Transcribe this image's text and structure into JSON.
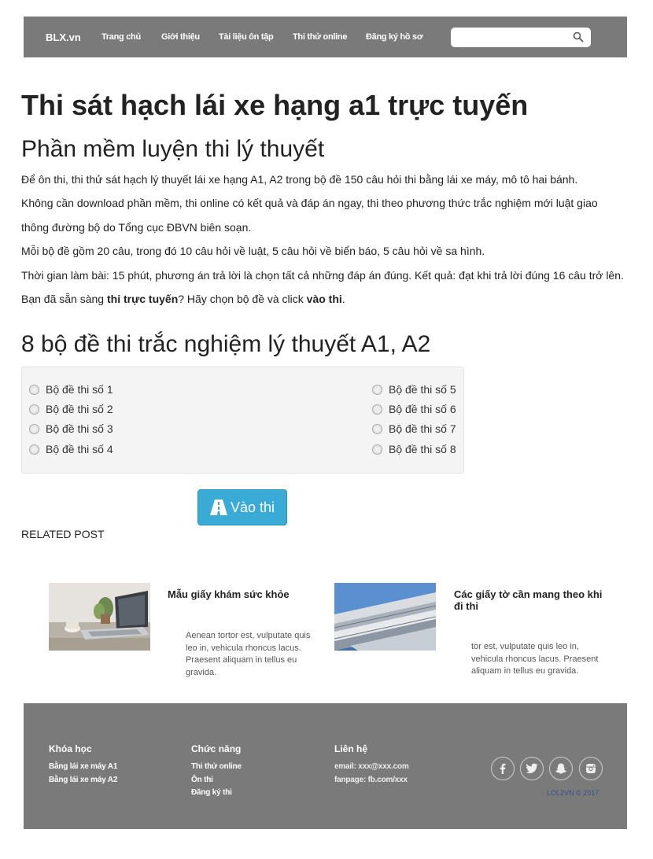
{
  "nav": {
    "brand": "BLX.vn",
    "links": [
      "Trang chủ",
      "Giới thiệu",
      "Tài liệu ôn tập",
      "Thi thử online",
      "Đăng ký hồ sơ"
    ],
    "search_placeholder": ""
  },
  "main": {
    "title": "Thi sát hạch lái xe hạng a1 trực tuyến",
    "subtitle": "Phần mềm luyện thi lý thuyết",
    "paragraphs": [
      "Để ôn thi, thi thử sát hạch lý thuyết lái xe hạng A1, A2 trong bộ đề 150 câu hỏi thi bằng lái xe máy, mô tô hai bánh.",
      "Không cần download phần mềm, thi online có kết quả và đáp án ngay, thi theo phương thức trắc nghiệm mới luật giao",
      "thông đường bộ do Tổng cục ĐBVN biên soạn.",
      "Mỗi bộ đề gồm 20 câu, trong đó 10 câu hỏi về luật, 5 câu hỏi về biển báo, 5 câu hỏi về sa hình.",
      "Thời gian làm bài: 15 phút, phương án trả lời là chọn tất cả những đáp án đúng. Kết quả: đạt khi trả lời đúng 16 câu trở lên."
    ],
    "ready_prefix": "Bạn đã sẵn sàng ",
    "ready_bold1": "thi trực tuyến",
    "ready_middle": "? Hãy chọn bộ đề và click ",
    "ready_bold2": "vào thi",
    "ready_suffix": "."
  },
  "quiz": {
    "heading": "8 bộ đề thi trắc nghiệm lý thuyết A1, A2",
    "options": [
      "Bộ đề thi số 1",
      "Bộ đề thi số 2",
      "Bộ đề thi số 3",
      "Bộ đề thi số 4",
      "Bộ đề thi số 5",
      "Bộ đề thi số 6",
      "Bộ đề thi số 7",
      "Bộ đề thi số 8"
    ],
    "start_label": "Vào thi"
  },
  "related": {
    "title": "RELATED POST",
    "posts": [
      {
        "title": "Mẫu giấy khám sức khỏe",
        "excerpt": [
          "Aenean tortor est, vulputate quis",
          "leo in, vehicula rhoncus lacus.",
          "Praesent aliquam in tellus eu",
          "gravida."
        ]
      },
      {
        "title": "Các giấy tờ cần mang theo khi đi thi",
        "excerpt": [
          "tor est, vulputate quis leo in,",
          "vehicula rhoncus lacus. Praesent",
          "aliquam in tellus eu gravida."
        ]
      }
    ]
  },
  "footer": {
    "col1": {
      "heading": "Khóa học",
      "links": [
        "Bằng lái xe máy A1",
        "Bằng lái xe máy A2"
      ]
    },
    "col2": {
      "heading": "Chức năng",
      "links": [
        "Thi thử online",
        "Ôn thi",
        "Đăng ký thi"
      ]
    },
    "col3": {
      "heading": "Liên hệ",
      "lines": [
        "email: xxx@xxx.com",
        "fanpage: fb.com/xxx"
      ]
    },
    "social": [
      "facebook-icon",
      "twitter-icon",
      "snapchat-icon",
      "instagram-icon"
    ],
    "copyright": "LOL2VN © 2017"
  },
  "colors": {
    "nav_bg": "#7a7a7a",
    "footer_bg": "#7a7a7a",
    "button": "#3aaad6",
    "copyright": "#3b4f8a"
  }
}
